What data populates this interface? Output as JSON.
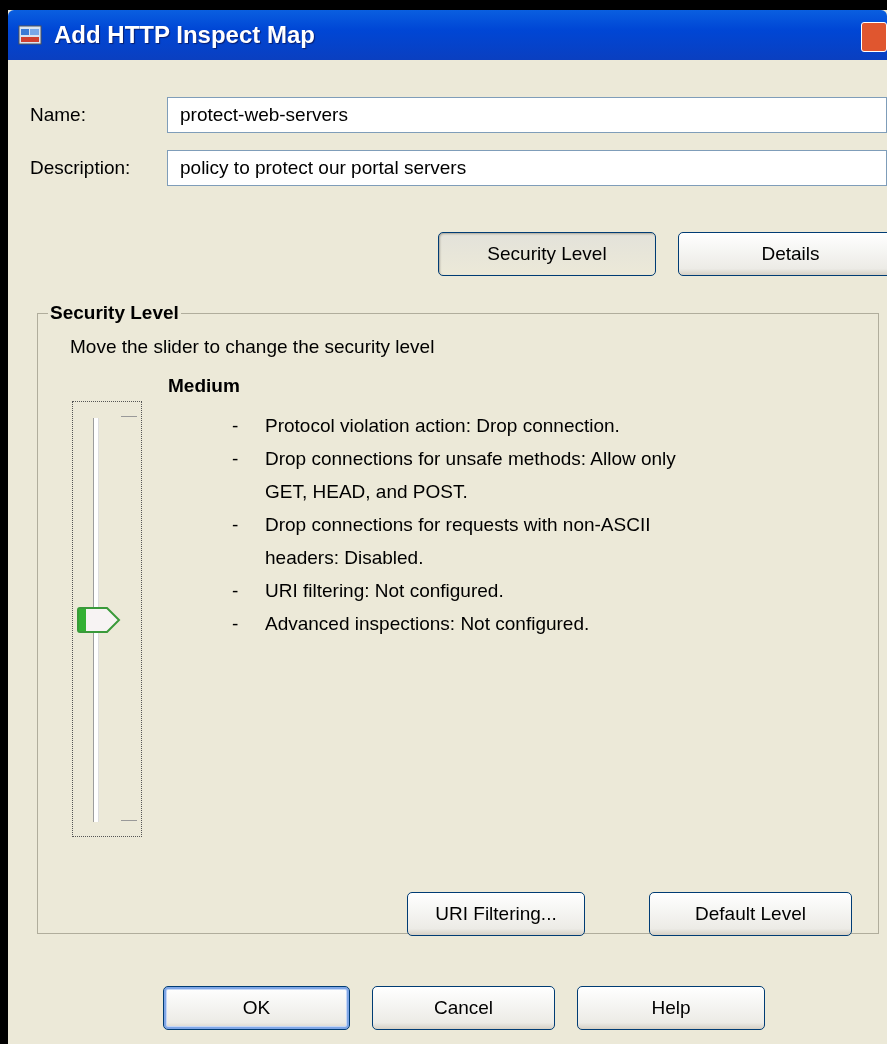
{
  "window": {
    "title": "Add HTTP Inspect Map"
  },
  "fields": [
    {
      "label": "Name:",
      "value": "protect-web-servers"
    },
    {
      "label": "Description:",
      "value": "policy to protect our portal servers"
    }
  ],
  "view_buttons": [
    {
      "label": "Security Level",
      "selected": true
    },
    {
      "label": "Details",
      "selected": false
    }
  ],
  "security_level": {
    "title": "Security Level",
    "instruction": "Move the slider to change the security level",
    "level_name": "Medium",
    "slider": {
      "level": 0.5
    },
    "settings": [
      "Protocol violation action: Drop connection.",
      "Drop connections for unsafe methods: Allow only GET, HEAD, and POST.",
      "Drop connections for requests with non-ASCII headers: Disabled.",
      "URI filtering: Not configured.",
      "Advanced inspections: Not configured."
    ],
    "bullet": "-",
    "buttons": [
      "URI Filtering...",
      "Default Level"
    ]
  },
  "buttons": [
    {
      "label": "OK",
      "default": true
    },
    {
      "label": "Cancel",
      "default": false
    },
    {
      "label": "Help",
      "default": false
    }
  ]
}
